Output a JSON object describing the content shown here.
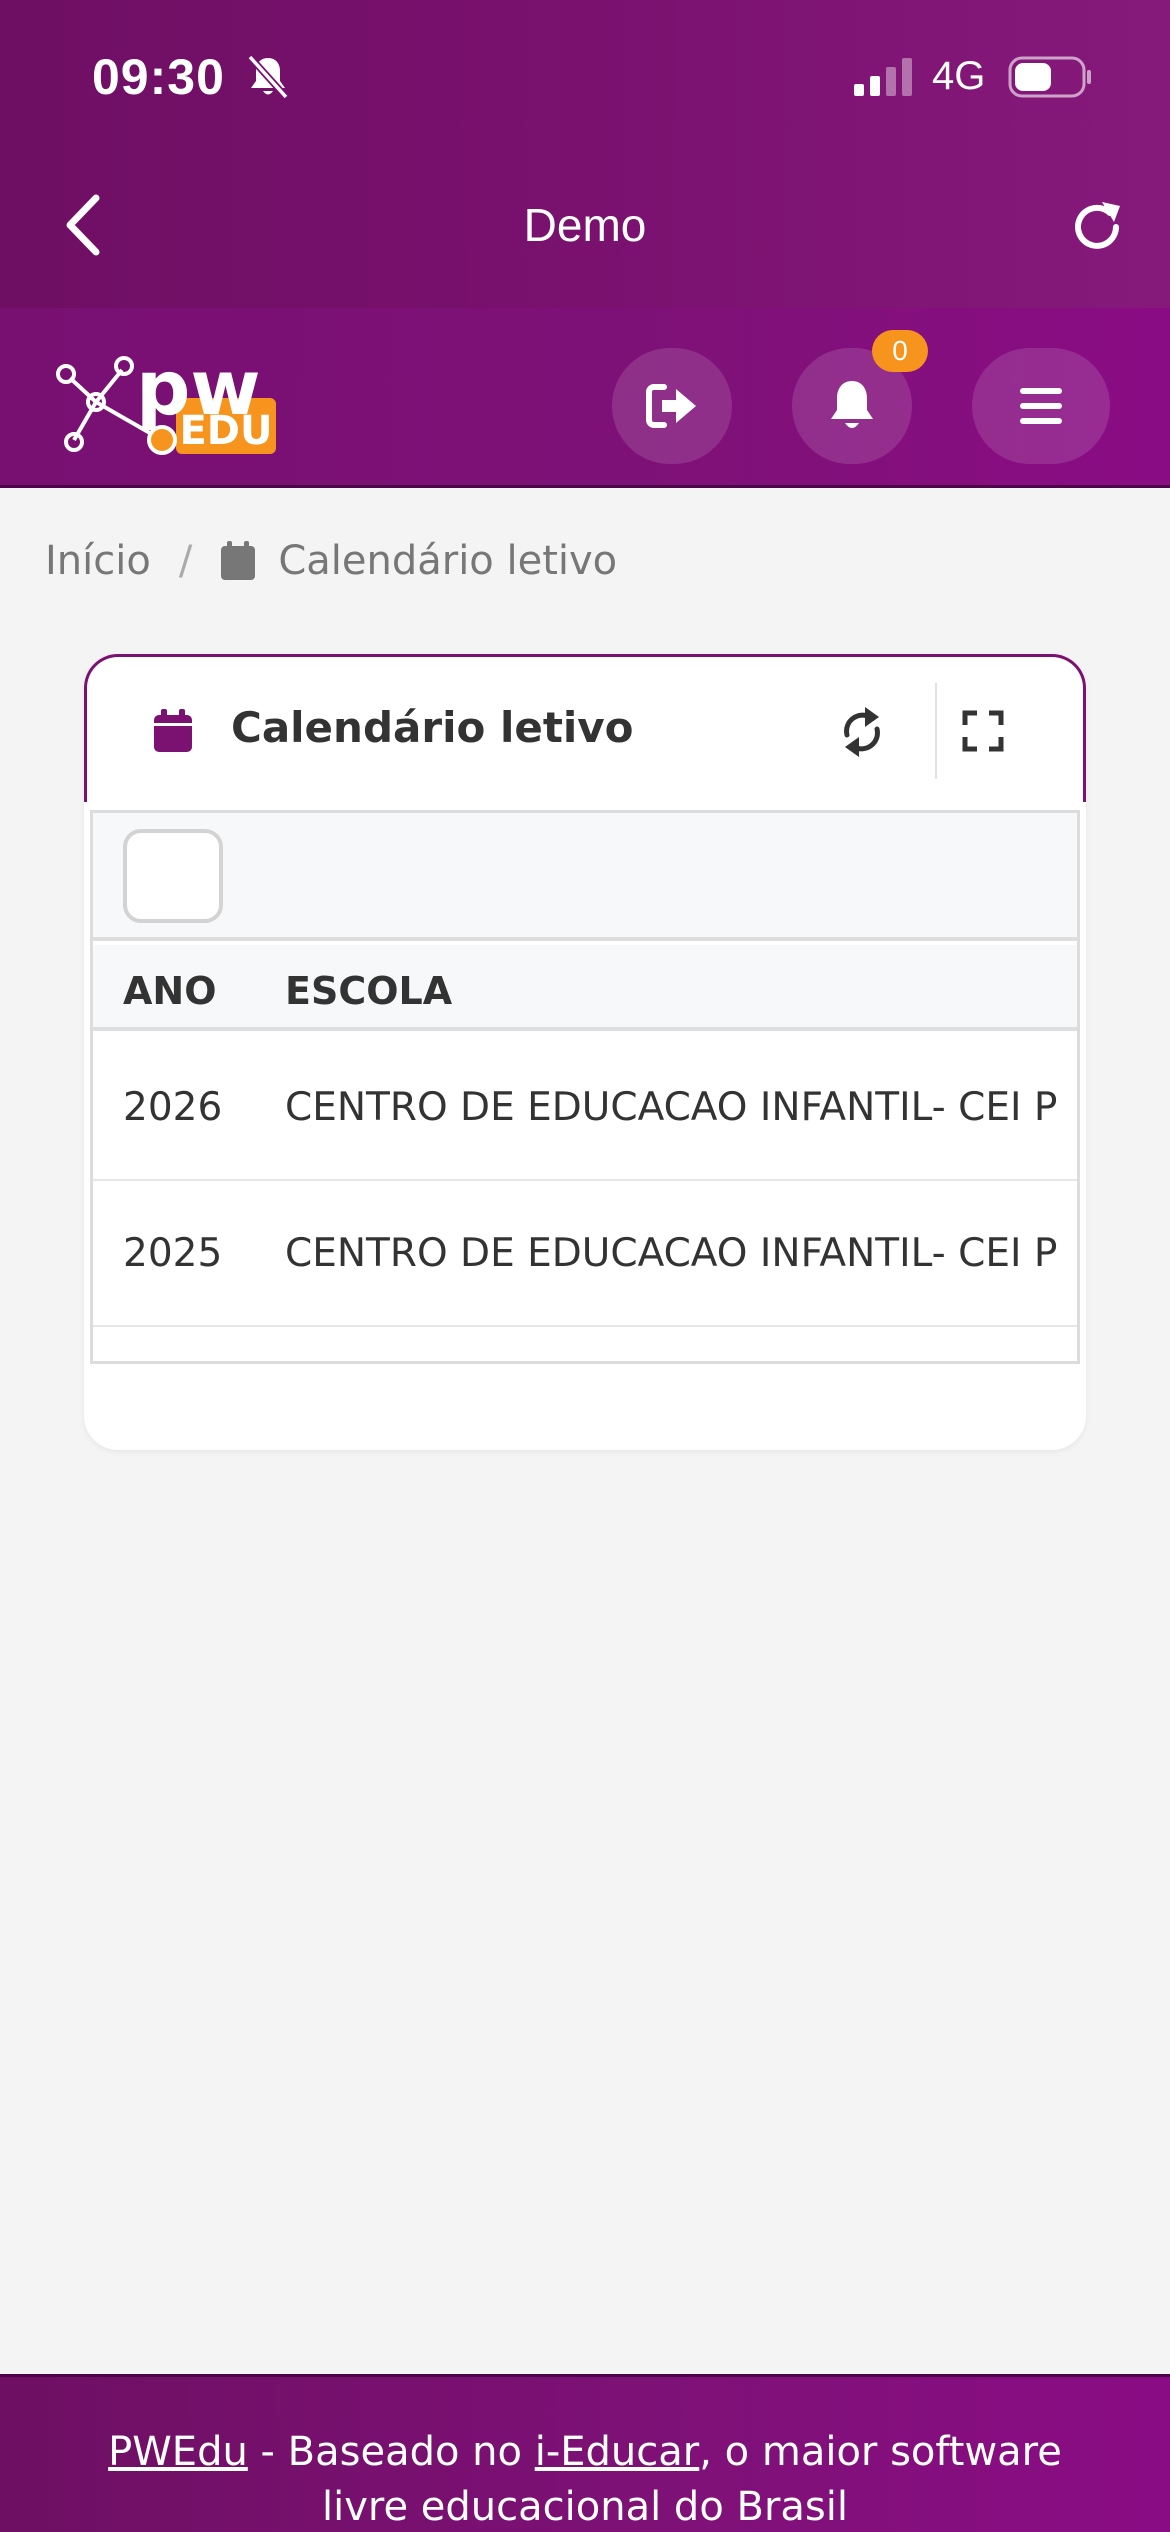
{
  "status_bar": {
    "time": "09:30",
    "network": "4G",
    "icons": [
      "bell-off-icon",
      "signal-icon",
      "battery-icon"
    ]
  },
  "nav": {
    "title": "Demo",
    "icons": [
      "back-icon",
      "reload-icon"
    ]
  },
  "app_bar": {
    "logo_text": "pw EDU",
    "notification_count": "0",
    "icons": [
      "sign-out-icon",
      "bell-icon",
      "hamburger-menu-icon"
    ]
  },
  "breadcrumb": {
    "home": "Início",
    "separator": "/",
    "current": "Calendário letivo"
  },
  "card": {
    "title": "Calendário letivo",
    "columns": [
      "ANO",
      "ESCOLA"
    ],
    "rows": [
      {
        "ano": "2026",
        "escola": "CENTRO DE EDUCACAO INFANTIL- CEI P"
      },
      {
        "ano": "2025",
        "escola": "CENTRO DE EDUCACAO INFANTIL- CEI P"
      }
    ]
  },
  "footer": {
    "link1": "PWEdu",
    "text1": " - Baseado no ",
    "link2": "i-Educar",
    "text2": ", o maior software",
    "line2": "livre educacional do Brasil"
  },
  "colors": {
    "brand_purple": "#7b1170",
    "accent_orange": "#f7941d",
    "background": "#f4f4f4"
  }
}
